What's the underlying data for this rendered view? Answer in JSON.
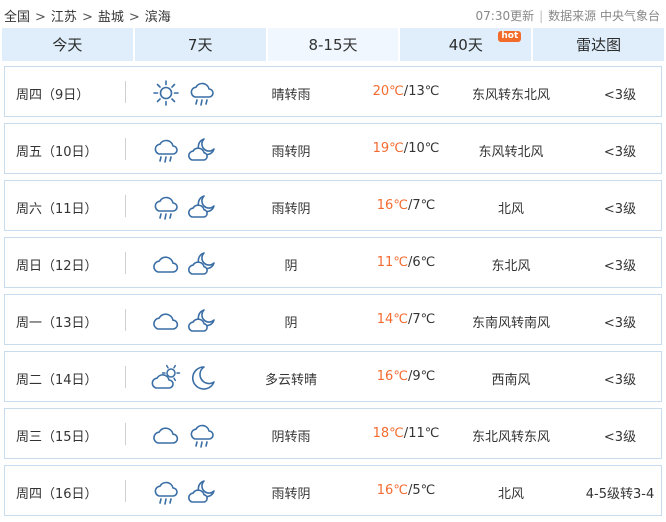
{
  "breadcrumb": {
    "items": [
      "全国",
      "江苏",
      "盐城",
      "滨海"
    ],
    "separator": ">"
  },
  "meta": {
    "updated": "07:30更新",
    "source": "数据来源 中央气象台"
  },
  "tabs": [
    {
      "label": "今天"
    },
    {
      "label": "7天"
    },
    {
      "label": "8-15天",
      "active": true
    },
    {
      "label": "40天",
      "badge": "hot"
    },
    {
      "label": "雷达图"
    }
  ],
  "colors": {
    "tab_bg": "#dfeefa",
    "tab_active_bg": "#f0f7ff",
    "hot_badge": "#f26b2a",
    "high_temp": "#f36b30",
    "row_border": "#c9dcee",
    "icon_stroke": "#3a6ea5"
  },
  "forecast": [
    {
      "day": "周四（9日）",
      "icon1": "sun-icon",
      "icon2": "cloud-rain-icon",
      "condition": "晴转雨",
      "high": "20℃",
      "low": "13℃",
      "wind": "东风转东北风",
      "level": "<3级"
    },
    {
      "day": "周五（10日）",
      "icon1": "cloud-rain-icon",
      "icon2": "cloud-moon-icon",
      "condition": "雨转阴",
      "high": "19℃",
      "low": "10℃",
      "wind": "东风转北风",
      "level": "<3级"
    },
    {
      "day": "周六（11日）",
      "icon1": "cloud-rain-icon",
      "icon2": "cloud-moon-icon",
      "condition": "雨转阴",
      "high": "16℃",
      "low": "7℃",
      "wind": "北风",
      "level": "<3级"
    },
    {
      "day": "周日（12日）",
      "icon1": "cloudy-icon",
      "icon2": "cloud-moon-icon",
      "condition": "阴",
      "high": "11℃",
      "low": "6℃",
      "wind": "东北风",
      "level": "<3级"
    },
    {
      "day": "周一（13日）",
      "icon1": "cloudy-icon",
      "icon2": "cloud-moon-icon",
      "condition": "阴",
      "high": "14℃",
      "low": "7℃",
      "wind": "东南风转南风",
      "level": "<3级"
    },
    {
      "day": "周二（14日）",
      "icon1": "partly-cloudy-icon",
      "icon2": "moon-icon",
      "condition": "多云转晴",
      "high": "16℃",
      "low": "9℃",
      "wind": "西南风",
      "level": "<3级"
    },
    {
      "day": "周三（15日）",
      "icon1": "cloudy-icon",
      "icon2": "cloud-rain-icon",
      "condition": "阴转雨",
      "high": "18℃",
      "low": "11℃",
      "wind": "东北风转东风",
      "level": "<3级"
    },
    {
      "day": "周四（16日）",
      "icon1": "cloud-rain-icon",
      "icon2": "cloud-moon-icon",
      "condition": "雨转阴",
      "high": "16℃",
      "low": "5℃",
      "wind": "北风",
      "level": "4-5级转3-4"
    }
  ]
}
